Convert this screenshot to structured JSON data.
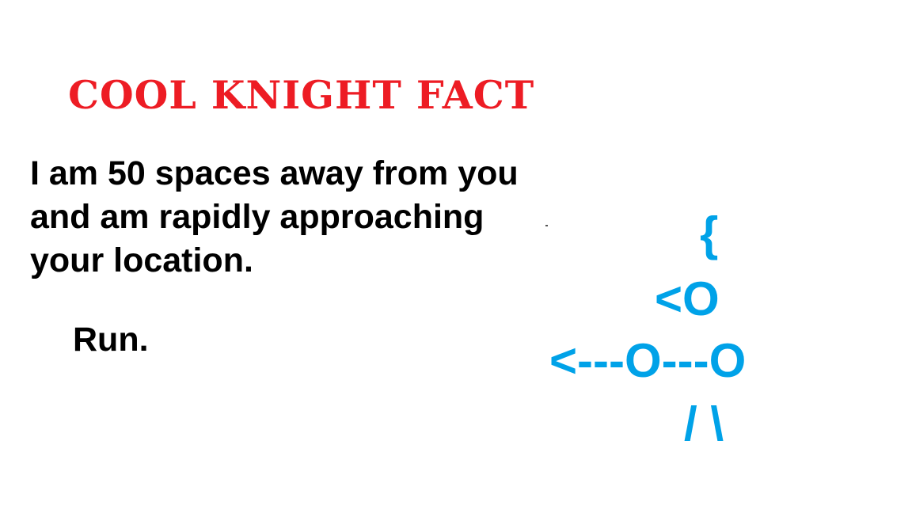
{
  "title": "COOL KNIGHT FACT",
  "fact_lines": [
    "I am 50 spaces away from you",
    "and am rapidly approaching",
    "your location."
  ],
  "closing": "Run.",
  "knight": {
    "plume": "{",
    "head": "<O",
    "arms": "<---O---O",
    "legs": "/ \\"
  },
  "colors": {
    "title": "#ed1c24",
    "text": "#000000",
    "knight": "#00a2e8",
    "background": "#ffffff"
  }
}
